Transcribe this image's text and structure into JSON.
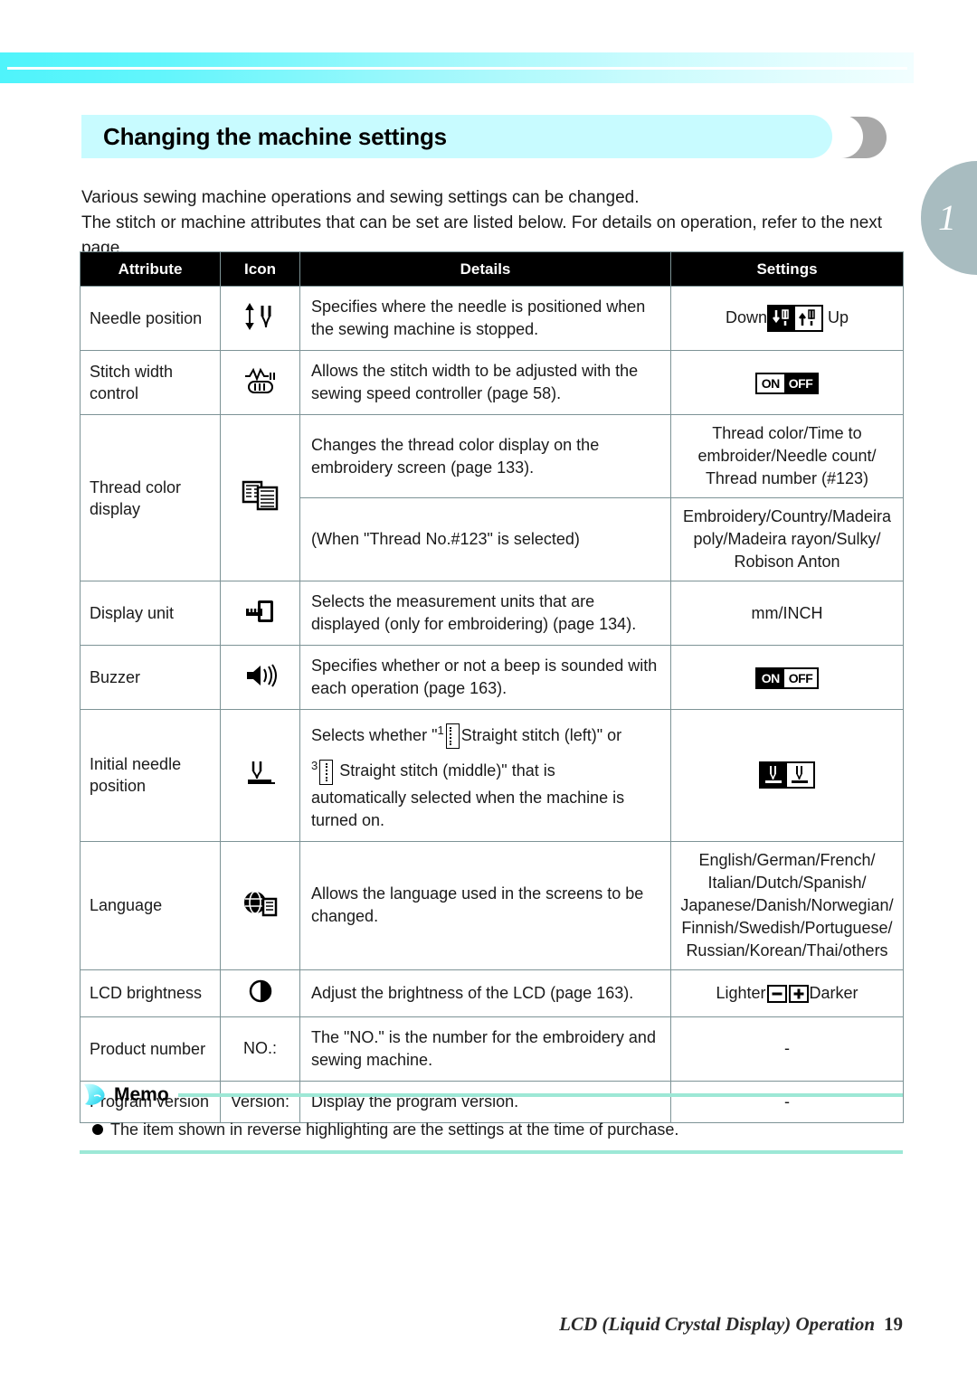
{
  "page": {
    "title": "Changing the machine settings",
    "chapter_tab": "1",
    "intro_line1": "Various sewing machine operations and sewing settings can be changed.",
    "intro_line2": "The stitch or machine attributes that can be set are listed below. For details on operation, refer to the next page.",
    "footer_text": "LCD (Liquid Crystal Display) Operation",
    "footer_page": "19"
  },
  "table": {
    "headers": {
      "attribute": "Attribute",
      "icon": "Icon",
      "details": "Details",
      "settings": "Settings"
    },
    "rows": [
      {
        "attribute": "Needle position",
        "icon_name": "needle-position-icon",
        "details": "Specifies where the needle is positioned when the sewing machine is stopped.",
        "settings_prefix": "Down",
        "settings_suffix": "Up",
        "settings_badge": "needle-down-up-badge"
      },
      {
        "attribute": "Stitch width control",
        "icon_name": "stitch-width-control-icon",
        "details": "Allows the stitch width to be adjusted with the sewing speed controller (page 58).",
        "settings_badge": "on-off-badge",
        "on_label": "ON",
        "off_label": "OFF",
        "selected": "OFF"
      },
      {
        "attribute": "Thread color display",
        "icon_name": "thread-color-display-icon",
        "details_a": "Changes the thread color display on the embroidery screen (page 133).",
        "settings_a": "Thread color/Time to embroider/Needle count/ Thread number (#123)",
        "details_b": "(When \"Thread No.#123\" is selected)",
        "settings_b": "Embroidery/Country/Madeira poly/Madeira rayon/Sulky/ Robison Anton"
      },
      {
        "attribute": "Display unit",
        "icon_name": "display-unit-icon",
        "details": "Selects the measurement units that are displayed (only for embroidering) (page 134).",
        "settings": "mm/INCH"
      },
      {
        "attribute": "Buzzer",
        "icon_name": "buzzer-icon",
        "details": "Specifies whether or not a beep is sounded with each operation (page 163).",
        "settings_badge": "on-off-badge",
        "on_label": "ON",
        "off_label": "OFF",
        "selected": "ON"
      },
      {
        "attribute": "Initial needle position",
        "icon_name": "initial-needle-position-icon",
        "details_part1": "Selects whether \"",
        "details_sup1": "1",
        "details_part2": "Straight stitch (left)\" or",
        "details_sup2": "3",
        "details_part3": "Straight stitch (middle)\" that is",
        "details_part4": "automatically selected when the machine is turned on.",
        "settings_badge": "needle-left-middle-badge"
      },
      {
        "attribute": "Language",
        "icon_name": "language-icon",
        "details": "Allows the language used in the screens to be changed.",
        "settings": "English/German/French/ Italian/Dutch/Spanish/ Japanese/Danish/Norwegian/ Finnish/Swedish/Portuguese/ Russian/Korean/Thai/others"
      },
      {
        "attribute": "LCD brightness",
        "icon_name": "lcd-brightness-icon",
        "details": "Adjust the brightness of the LCD (page 163).",
        "settings_prefix": "Lighter",
        "settings_suffix": "Darker",
        "settings_badge": "minus-plus-buttons"
      },
      {
        "attribute": "Product number",
        "icon_text": "NO.:",
        "details": "The \"NO.\" is the number for the embroidery and sewing machine.",
        "settings": "-"
      },
      {
        "attribute": "Program version",
        "icon_text": "Version:",
        "details": "Display the program version.",
        "settings": "-"
      }
    ]
  },
  "memo": {
    "title": "Memo",
    "item": "The item shown in reverse highlighting are the settings at the time of purchase."
  },
  "colors": {
    "banner_cyan": "#4ff4fb",
    "title_bar": "#c8fbff",
    "chapter_tab": "#a8bcc0",
    "table_border": "#7d9396",
    "header_bg": "#000000",
    "memo_rule": "#9de8d6"
  }
}
